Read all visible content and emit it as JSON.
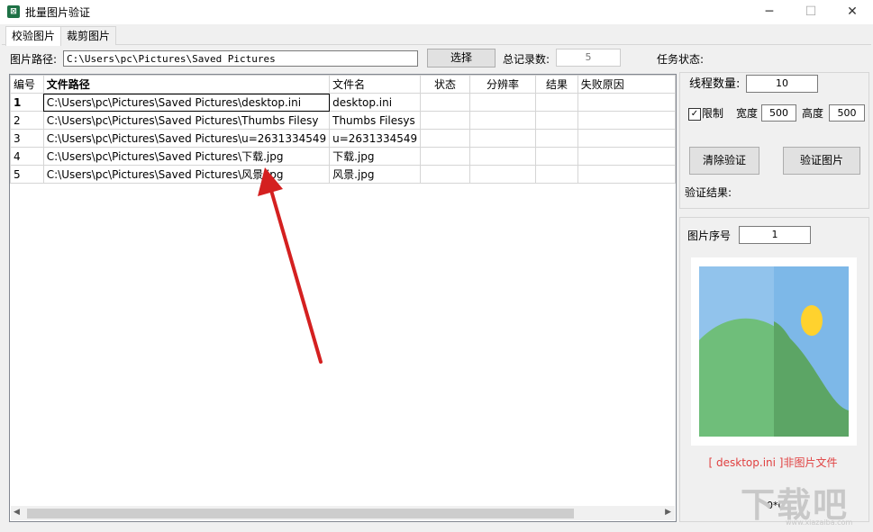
{
  "window": {
    "title": "批量图片验证",
    "minimize": "─",
    "maximize": "☐",
    "close": "✕",
    "icon_glyph": "⊠"
  },
  "tabs": [
    {
      "label": "校验图片"
    },
    {
      "label": "裁剪图片"
    }
  ],
  "toolbar": {
    "path_label": "图片路径:",
    "path_value": "C:\\Users\\pc\\Pictures\\Saved Pictures",
    "select_button": "选择",
    "total_label": "总记录数:",
    "total_value": "5",
    "task_status_label": "任务状态:"
  },
  "table": {
    "columns": [
      "编号",
      "文件路径",
      "文件名",
      "状态",
      "分辨率",
      "结果",
      "失败原因"
    ],
    "rows": [
      {
        "id": "1",
        "path": "C:\\Users\\pc\\Pictures\\Saved Pictures\\desktop.ini",
        "name": "desktop.ini"
      },
      {
        "id": "2",
        "path": "C:\\Users\\pc\\Pictures\\Saved Pictures\\Thumbs Filesy",
        "name": "Thumbs Filesys"
      },
      {
        "id": "3",
        "path": "C:\\Users\\pc\\Pictures\\Saved Pictures\\u=2631334549",
        "name": "u=2631334549"
      },
      {
        "id": "4",
        "path": "C:\\Users\\pc\\Pictures\\Saved Pictures\\下载.jpg",
        "name": "下载.jpg"
      },
      {
        "id": "5",
        "path": "C:\\Users\\pc\\Pictures\\Saved Pictures\\风景.jpg",
        "name": "风景.jpg"
      }
    ]
  },
  "settings": {
    "thread_label": "线程数量:",
    "thread_value": "10",
    "limit_label": "限制",
    "width_label": "宽度",
    "width_value": "500",
    "height_label": "高度",
    "height_value": "500",
    "clear_button": "清除验证",
    "verify_button": "验证图片",
    "result_label": "验证结果:"
  },
  "preview": {
    "index_label": "图片序号",
    "index_value": "1",
    "error_message": "[ desktop.ini ]非图片文件",
    "size_text": "0*0"
  },
  "watermark": {
    "text": "下载吧",
    "domain": "www.xiazaiba.com"
  },
  "colors": {
    "arrow": "#d42020",
    "sky": "#7db8e8",
    "hill_light": "#6fbe7a",
    "hill_dark": "#5ca565",
    "sun": "#ffd22e",
    "error": "#e04040"
  }
}
